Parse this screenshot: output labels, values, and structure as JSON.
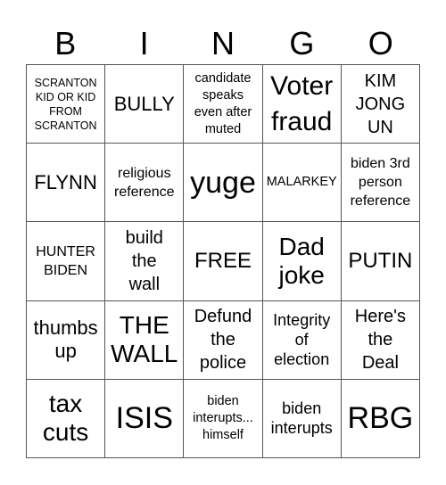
{
  "header": {
    "letters": [
      "B",
      "I",
      "N",
      "G",
      "O"
    ]
  },
  "cells": [
    [
      "SCRANTON\nKID OR KID\nFROM\nSCRANTON",
      "BULLY",
      "candidate\nspeaks\neven after\nmuted",
      "Voter\nfraud",
      "KIM\nJONG\nUN"
    ],
    [
      "FLYNN",
      "religious\nreference",
      "yuge",
      "MALARKEY",
      "biden 3rd\nperson\nreference"
    ],
    [
      "HUNTER\nBIDEN",
      "build\nthe\nwall",
      "FREE",
      "Dad\njoke",
      "PUTIN"
    ],
    [
      "thumbs\nup",
      "THE\nWALL",
      "Defund\nthe\npolice",
      "Integrity\nof\nelection",
      "Here's\nthe\nDeal"
    ],
    [
      "tax\ncuts",
      "ISIS",
      "biden\ninterupts...\nhimself",
      "biden\ninterupts",
      "RBG"
    ]
  ]
}
